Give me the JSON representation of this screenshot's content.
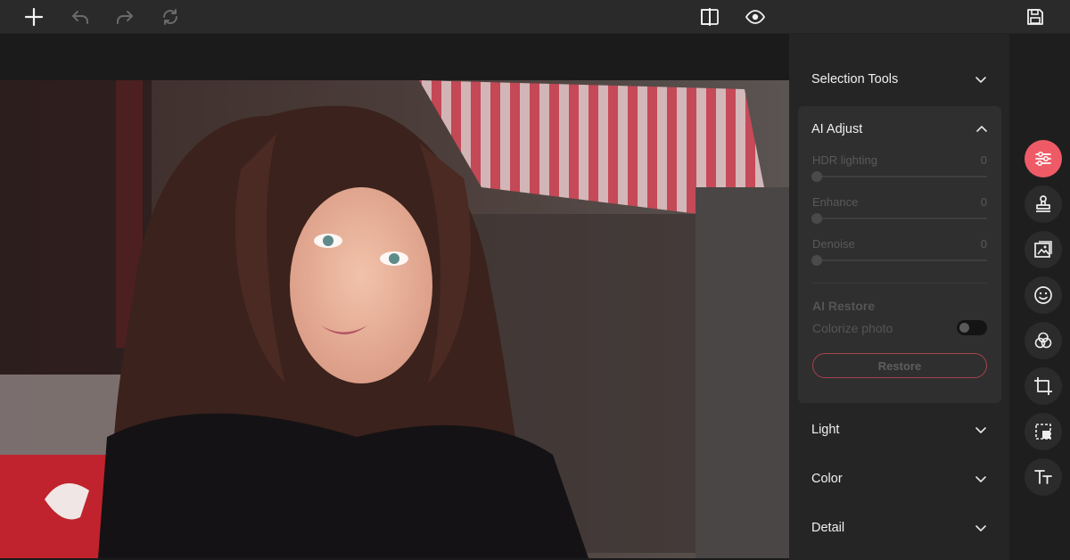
{
  "toolbar": {
    "left_icons": [
      "plus-icon",
      "undo-icon",
      "redo-icon",
      "reset-icon"
    ],
    "center_icons": [
      "compare-icon",
      "preview-eye-icon"
    ],
    "right_icons": [
      "save-icon"
    ]
  },
  "panel": {
    "sections": {
      "selection_tools": "Selection Tools",
      "ai_adjust": "AI Adjust",
      "light": "Light",
      "color": "Color",
      "detail": "Detail"
    },
    "ai_adjust": {
      "sliders": [
        {
          "label": "HDR lighting",
          "value": "0"
        },
        {
          "label": "Enhance",
          "value": "0"
        },
        {
          "label": "Denoise",
          "value": "0"
        }
      ],
      "restore_title": "AI Restore",
      "colorize_label": "Colorize photo",
      "colorize_on": false,
      "restore_button": "Restore"
    }
  },
  "tools": [
    {
      "name": "adjust-sliders-icon",
      "active": true
    },
    {
      "name": "stamp-icon",
      "active": false
    },
    {
      "name": "image-icon",
      "active": false
    },
    {
      "name": "face-retouch-icon",
      "active": false
    },
    {
      "name": "effects-circles-icon",
      "active": false
    },
    {
      "name": "crop-icon",
      "active": false
    },
    {
      "name": "select-area-icon",
      "active": false
    },
    {
      "name": "text-icon",
      "active": false
    }
  ],
  "colors": {
    "accent": "#ee5b67",
    "restore_border": "#a8424c"
  }
}
